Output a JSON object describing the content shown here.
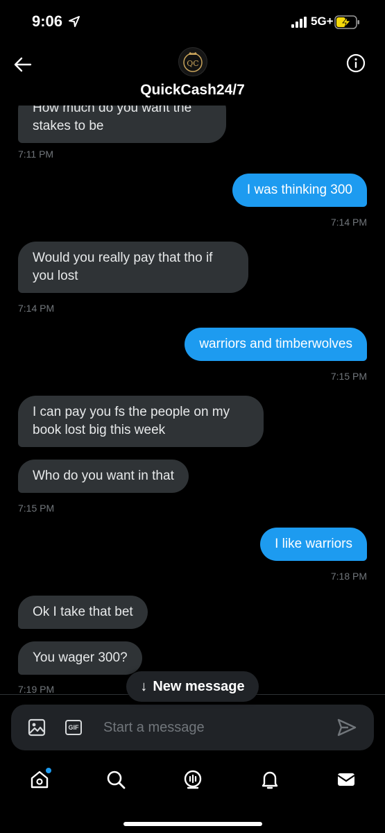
{
  "status_bar": {
    "time": "9:06",
    "network": "5G+"
  },
  "header": {
    "contact_name": "QuickCash24/7",
    "avatar_text": "QC"
  },
  "messages": [
    {
      "direction": "in",
      "text": "How much do you want the stakes to be",
      "time": "7:11 PM"
    },
    {
      "direction": "out",
      "text": "I was thinking 300",
      "time": "7:14 PM"
    },
    {
      "direction": "in",
      "text": "Would you really pay that tho if you lost",
      "time": "7:14 PM"
    },
    {
      "direction": "out",
      "text": "warriors and timberwolves",
      "time": "7:15 PM"
    },
    {
      "direction": "in",
      "text": "I can pay you fs the people on my book lost big this week",
      "time": ""
    },
    {
      "direction": "in",
      "text": "Who do you want in that",
      "time": "7:15 PM"
    },
    {
      "direction": "out",
      "text": "I like warriors",
      "time": "7:18 PM"
    },
    {
      "direction": "in",
      "text": "Ok I take that bet",
      "time": ""
    },
    {
      "direction": "in",
      "text": "You wager 300?",
      "time": "7:19 PM"
    }
  ],
  "new_message_pill": {
    "label": "New message",
    "arrow": "↓"
  },
  "composer": {
    "placeholder": "Start a message",
    "gif_label": "GIF"
  },
  "tabbar": {
    "items": [
      "home-icon",
      "search-icon",
      "spaces-icon",
      "notifications-icon",
      "messages-icon"
    ]
  },
  "colors": {
    "background": "#000000",
    "incoming_bubble": "#2f3336",
    "outgoing_bubble": "#1d9bf0",
    "timestamp": "#71767b"
  }
}
